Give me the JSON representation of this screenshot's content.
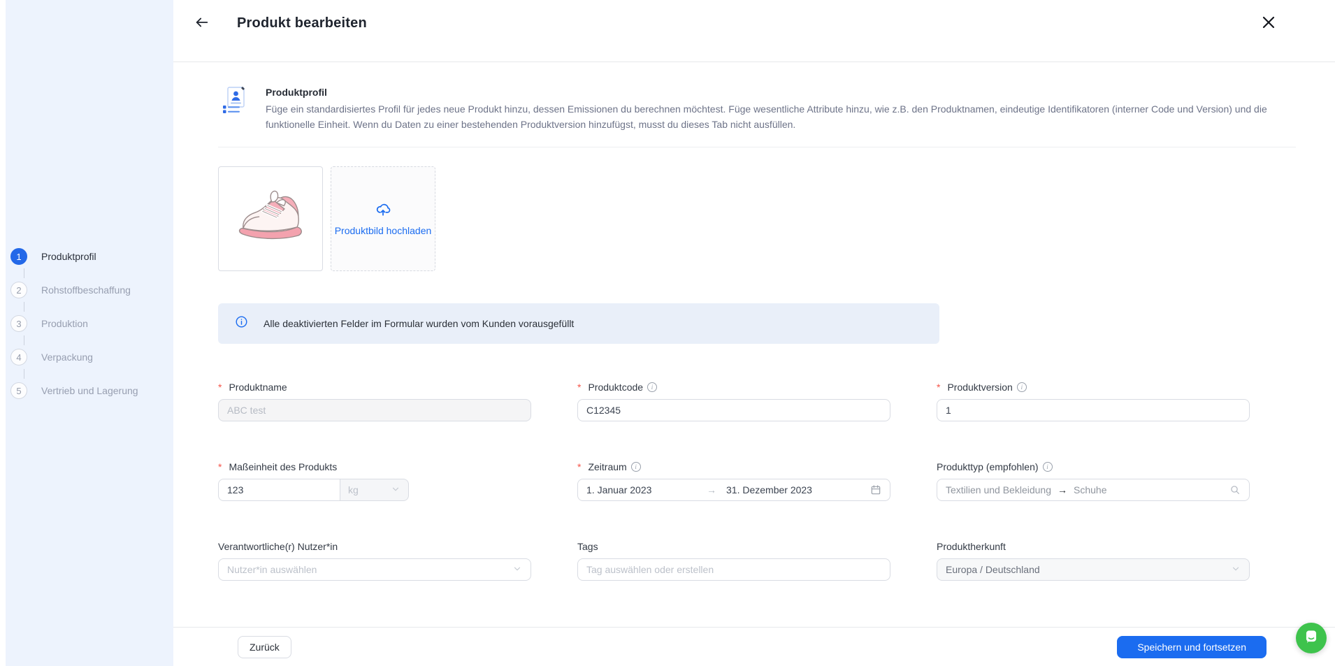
{
  "colors": {
    "primary": "#1b6cf0",
    "sidebar_bg": "#edf3fd",
    "banner_bg": "#e9eff9",
    "chat_green": "#3ec34c",
    "active_step": "#2368e8"
  },
  "header": {
    "title": "Produkt bearbeiten"
  },
  "stepper": [
    {
      "num": "1",
      "label": "Produktprofil",
      "active": true
    },
    {
      "num": "2",
      "label": "Rohstoffbeschaffung",
      "active": false
    },
    {
      "num": "3",
      "label": "Produktion",
      "active": false
    },
    {
      "num": "4",
      "label": "Verpackung",
      "active": false
    },
    {
      "num": "5",
      "label": "Vertrieb und Lagerung",
      "active": false
    }
  ],
  "section": {
    "title": "Produktprofil",
    "description": "Füge ein standardisiertes Profil für jedes neue Produkt hinzu, dessen Emissionen du berechnen möchtest. Füge wesentliche Attribute hinzu, wie z.B. den Produktnamen, eindeutige Identifikatoren (interner Code und Version) und die funktionelle Einheit. Wenn du Daten zu einer bestehenden Produktversion hinzufügst, musst du dieses Tab nicht ausfüllen."
  },
  "media": {
    "image_name": "pink-sneaker-illustration",
    "upload_label": "Produktbild hochladen"
  },
  "banner": {
    "text": "Alle deaktivierten Felder im Formular wurden vom Kunden vorausgefüllt"
  },
  "form": {
    "produktname": {
      "label": "Produktname",
      "value": "ABC test",
      "disabled": true
    },
    "produktcode": {
      "label": "Produktcode",
      "value": "C12345"
    },
    "produktversion": {
      "label": "Produktversion",
      "value": "1"
    },
    "masseinheit": {
      "label": "Maßeinheit des Produkts",
      "value": "123",
      "unit": "kg"
    },
    "zeitraum": {
      "label": "Zeitraum",
      "start": "1. Januar 2023",
      "end": "31. Dezember 2023"
    },
    "produkttyp": {
      "label": "Produkttyp (empfohlen)",
      "category": "Textilien und Bekleidung",
      "subcategory": "Schuhe"
    },
    "nutzer": {
      "label": "Verantwortliche(r) Nutzer*in",
      "placeholder": "Nutzer*in auswählen"
    },
    "tags": {
      "label": "Tags",
      "placeholder": "Tag auswählen oder erstellen"
    },
    "herkunft": {
      "label": "Produktherkunft",
      "value": "Europa / Deutschland"
    }
  },
  "footer": {
    "back_label": "Zurück",
    "submit_label": "Speichern und fortsetzen"
  }
}
